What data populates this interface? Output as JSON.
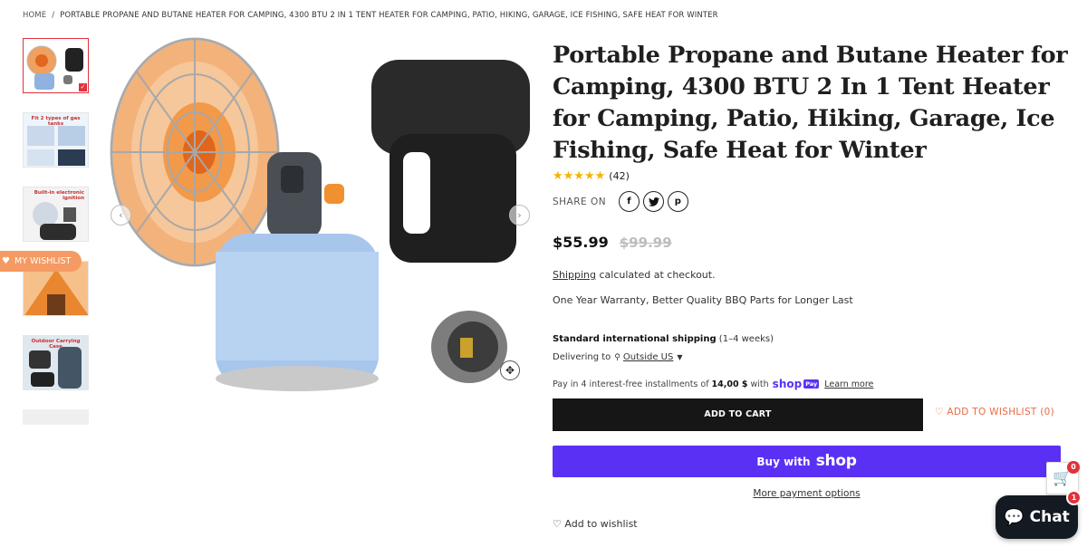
{
  "breadcrumb": {
    "home": "HOME",
    "separator": "/",
    "current": "PORTABLE PROPANE AND BUTANE HEATER FOR CAMPING, 4300 BTU 2 IN 1 TENT HEATER FOR CAMPING, PATIO, HIKING, GARAGE, ICE FISHING, SAFE HEAT FOR WINTER"
  },
  "thumbnails": {
    "items": [
      {
        "caption": ""
      },
      {
        "caption": "Fit 2 types of gas tanks"
      },
      {
        "caption": "Built-in electronic ignition"
      },
      {
        "caption": ""
      },
      {
        "caption": "Outdoor Carrying Case"
      }
    ]
  },
  "wishlist_tab": {
    "label": "MY WISHLIST"
  },
  "product": {
    "title": "Portable Propane and Butane Heater for Camping, 4300 BTU 2 In 1 Tent Heater for Camping, Patio, Hiking, Garage, Ice Fishing, Safe Heat for Winter",
    "rating_stars": 5,
    "stars": "★★★★★",
    "review_count": "(42)",
    "share_label": "SHARE ON",
    "social": {
      "facebook": "f",
      "twitter": "t",
      "pinterest": "p"
    },
    "price": "$55.99",
    "compare_price": "$99.99",
    "shipping_link": "Shipping",
    "shipping_note": " calculated at checkout.",
    "warranty": "One Year Warranty, Better Quality BBQ Parts for Longer Last",
    "std_shipping_bold": "Standard international shipping",
    "std_shipping_time": " (1–4 weeks)",
    "delivering_label": "Delivering to",
    "delivering_location": "Outside US",
    "installments_prefix": "Pay in 4 interest-free installments of",
    "installments_amount": "14,00 $",
    "installments_with": "with",
    "shop_logo": "shop",
    "pay_badge": "Pay",
    "learn_more": "Learn more",
    "add_to_cart": "ADD TO CART",
    "add_to_wishlist": "ADD TO WISHLIST",
    "wishlist_count": "(0)",
    "buy_with": "Buy with",
    "buy_shop": "shop",
    "more_payment": "More payment options",
    "add_wishlist_link": "Add to wishlist"
  },
  "floating_cart": {
    "count": "0"
  },
  "chat": {
    "label": "Chat",
    "badge": "1"
  },
  "colors": {
    "accent_purple": "#5a31f4",
    "wishlist_orange": "#e86b45",
    "star": "#f4b400",
    "badge_red": "#e0323c"
  }
}
